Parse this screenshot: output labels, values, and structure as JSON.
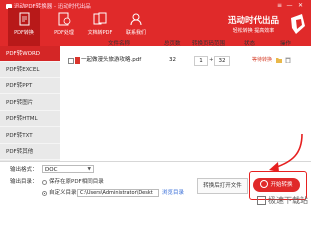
{
  "app": {
    "title": "迅动PDF转换器 - 迅动时代出品",
    "controls": {
      "menu": "≡",
      "minimize": "—",
      "close": "✕"
    }
  },
  "tabs": [
    {
      "label": "PDF转换",
      "icon": "pdf-convert-icon",
      "active": true
    },
    {
      "label": "PDF处理",
      "icon": "pdf-process-icon",
      "active": false
    },
    {
      "label": "文档转PDF",
      "icon": "doc-to-pdf-icon",
      "active": false
    },
    {
      "label": "联系我们",
      "icon": "contact-icon",
      "active": false
    }
  ],
  "brand": {
    "name": "迅动时代出品",
    "slogan": "轻松转换 提高效率"
  },
  "sidebar": {
    "items": [
      {
        "label": "PDF转WORD",
        "active": true
      },
      {
        "label": "PDF转EXCEL",
        "active": false
      },
      {
        "label": "PDF转PPT",
        "active": false
      },
      {
        "label": "PDF转图片",
        "active": false
      },
      {
        "label": "PDF转HTML",
        "active": false
      },
      {
        "label": "PDF转TXT",
        "active": false
      },
      {
        "label": "PDF转其他",
        "active": false
      }
    ]
  },
  "table": {
    "headers": {
      "file": "文件名称",
      "pages": "总页数",
      "range": "转换页码范围",
      "status": "状态",
      "ops": "操作"
    },
    "rows": [
      {
        "name": "一起做漫头旅游攻略.pdf",
        "pages": "32",
        "from": "1",
        "to": "32",
        "status": "等待转换"
      }
    ]
  },
  "footer": {
    "format_label": "输出格式：",
    "format_value": "DOC",
    "output_label": "输出目录：",
    "radio_same": "保存在原PDF相同目录",
    "radio_custom": "自定义目录：",
    "path": "C:\\Users\\Administrator\\Deskt",
    "browse": "浏览目录",
    "open_folder": "转换后打开文件",
    "start": "开始转换"
  },
  "watermark": "极速下载站",
  "colors": {
    "brand_red": "#e02a2a",
    "active_tab": "#b81919",
    "sidebar_bg": "#e9e9e9",
    "status": "#d7432e",
    "link": "#3a6fd8"
  }
}
